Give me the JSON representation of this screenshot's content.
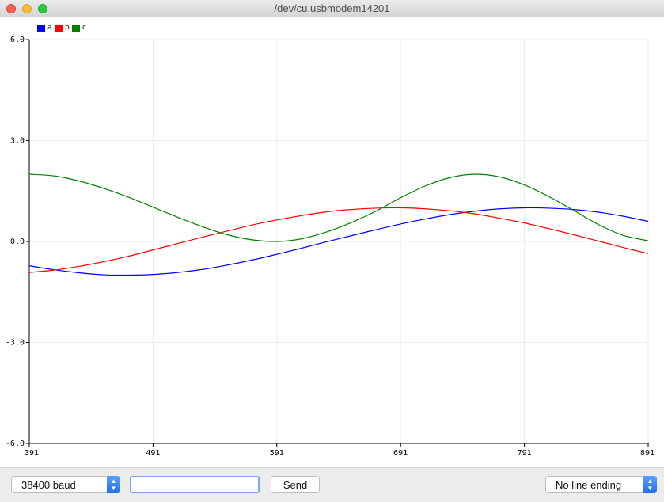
{
  "window": {
    "title": "/dev/cu.usbmodem14201"
  },
  "bottom_bar": {
    "baud": "38400 baud",
    "input_value": "",
    "send_label": "Send",
    "line_ending": "No line ending"
  },
  "chart_data": {
    "type": "line",
    "title": "",
    "xlabel": "",
    "ylabel": "",
    "xlim": [
      391,
      891
    ],
    "ylim": [
      -6.0,
      6.0
    ],
    "x_ticks": [
      391,
      491,
      591,
      691,
      791,
      891
    ],
    "y_ticks": [
      6.0,
      3.0,
      0.0,
      -3.0,
      -6.0
    ],
    "y_tick_labels": [
      "6.0",
      "3.0",
      "0.0",
      "-3.0",
      "-6.0"
    ],
    "grid": true,
    "legend_position": "top-left",
    "series": [
      {
        "name": "a",
        "color": "#0000ff",
        "x": [
          391,
          411,
          431,
          451,
          471,
          491,
          511,
          531,
          551,
          571,
          591,
          611,
          631,
          651,
          671,
          691,
          711,
          731,
          751,
          771,
          791,
          811,
          831,
          851,
          871,
          891
        ],
        "y": [
          -0.72,
          -0.84,
          -0.93,
          -0.99,
          -1.0,
          -0.98,
          -0.92,
          -0.83,
          -0.7,
          -0.55,
          -0.38,
          -0.2,
          -0.01,
          0.17,
          0.35,
          0.52,
          0.67,
          0.8,
          0.9,
          0.97,
          1.0,
          0.99,
          0.95,
          0.87,
          0.75,
          0.6
        ]
      },
      {
        "name": "b",
        "color": "#ff0000",
        "x": [
          391,
          411,
          431,
          451,
          471,
          491,
          511,
          531,
          551,
          571,
          591,
          611,
          631,
          651,
          671,
          691,
          711,
          731,
          751,
          771,
          791,
          811,
          831,
          851,
          871,
          891
        ],
        "y": [
          -0.92,
          -0.85,
          -0.74,
          -0.6,
          -0.44,
          -0.25,
          -0.06,
          0.13,
          0.31,
          0.49,
          0.64,
          0.77,
          0.88,
          0.95,
          0.99,
          1.0,
          0.97,
          0.91,
          0.82,
          0.69,
          0.55,
          0.38,
          0.2,
          0.01,
          -0.18,
          -0.36
        ]
      },
      {
        "name": "c",
        "color": "#008000",
        "x": [
          391,
          411,
          431,
          451,
          471,
          491,
          511,
          531,
          551,
          571,
          591,
          611,
          631,
          651,
          671,
          691,
          711,
          731,
          751,
          771,
          791,
          811,
          831,
          851,
          871,
          891
        ],
        "y": [
          2.0,
          1.95,
          1.8,
          1.58,
          1.32,
          1.02,
          0.72,
          0.44,
          0.2,
          0.05,
          0.0,
          0.08,
          0.28,
          0.56,
          0.9,
          1.3,
          1.65,
          1.9,
          2.0,
          1.92,
          1.68,
          1.33,
          0.92,
          0.5,
          0.18,
          0.02
        ]
      }
    ]
  }
}
